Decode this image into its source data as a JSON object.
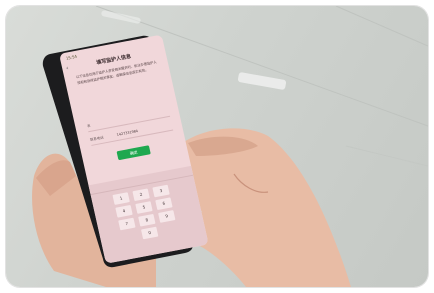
{
  "phone": {
    "status_time": "15:54",
    "back_icon": "‹",
    "title": "填写监护人信息",
    "description": "以下信息仅用于监护人享受相关服务时，依法办理监护人授权和后续监护相关事宜，请确保信息真实有效。",
    "name_label": "名",
    "name_value": "",
    "phone_label": "联系电话",
    "phone_value": "1427331984",
    "confirm_button": "确定",
    "keyboard_keys": [
      "1",
      "2",
      "3",
      "4",
      "5",
      "6",
      "7",
      "8",
      "9",
      "0"
    ]
  },
  "colors": {
    "screen_bg": "#f1d7da",
    "confirm_green": "#1fa84f",
    "phone_body": "#1c1c1e",
    "wall": "#d2d5d1"
  }
}
